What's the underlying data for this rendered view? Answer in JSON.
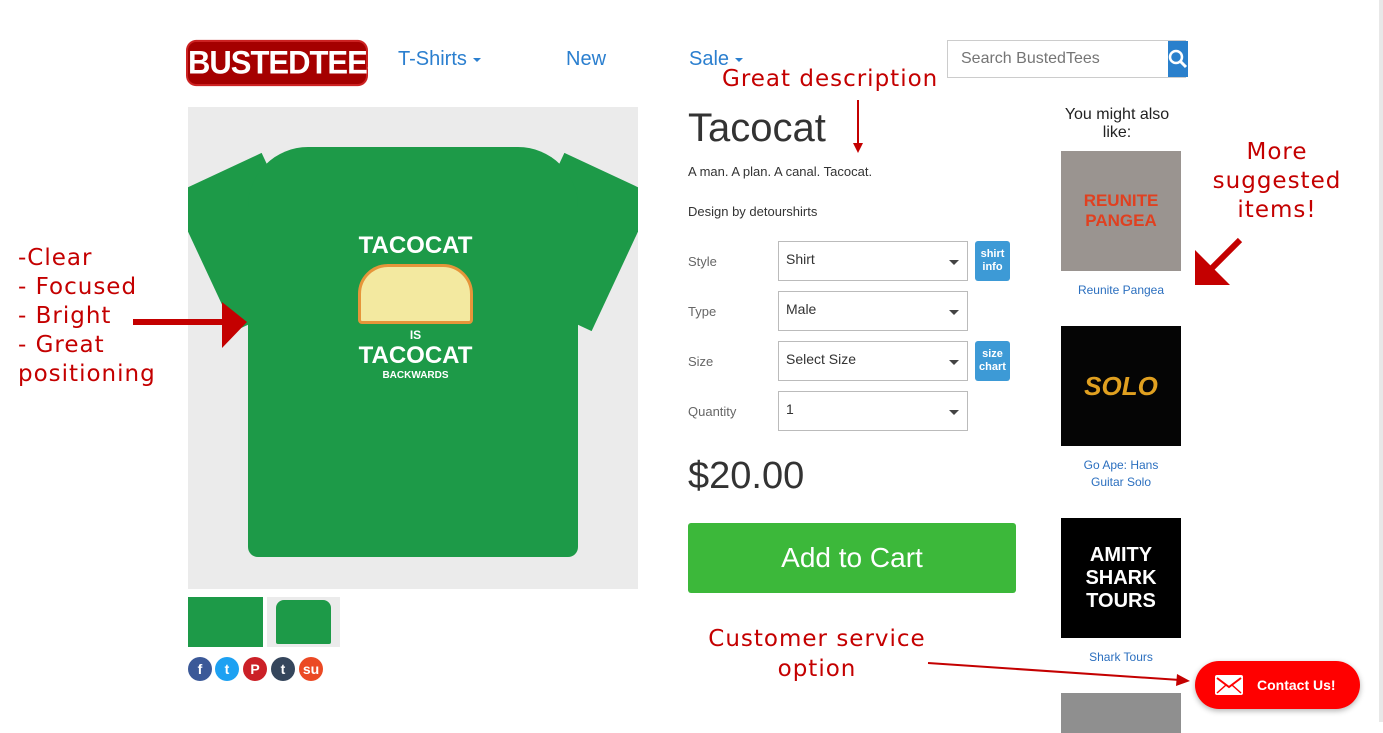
{
  "header": {
    "logo": "BUSTEDTEES",
    "nav": [
      {
        "label": "T-Shirts",
        "dropdown": true
      },
      {
        "label": "New",
        "dropdown": false
      },
      {
        "label": "Sale",
        "dropdown": true
      }
    ],
    "search_placeholder": "Search BustedTees",
    "search_icon": "search-icon"
  },
  "product": {
    "title": "Tacocat",
    "description": "A man. A plan. A canal. Tacocat.",
    "designer": "Design by detourshirts",
    "art_lines": [
      "TACOCAT",
      "IS",
      "TACOCAT",
      "BACKWARDS"
    ],
    "shirt_color": "#1d9a48",
    "options": [
      {
        "label": "Style",
        "value": "Shirt",
        "button": "shirt info"
      },
      {
        "label": "Type",
        "value": "Male"
      },
      {
        "label": "Size",
        "value": "Select Size",
        "button": "size chart"
      },
      {
        "label": "Quantity",
        "value": "1"
      }
    ],
    "price": "$20.00",
    "add_to_cart": "Add to Cart"
  },
  "social": [
    "facebook",
    "twitter",
    "pinterest",
    "tumblr",
    "stumbleupon"
  ],
  "suggestions": {
    "heading": "You might also like:",
    "items": [
      {
        "name": "Reunite Pangea",
        "art": "REUNITE PANGEA"
      },
      {
        "name": "Go Ape: Hans Guitar Solo",
        "art": "SOLO"
      },
      {
        "name": "Shark Tours",
        "art": "AMITY SHARK TOURS"
      }
    ]
  },
  "contact": {
    "label": "Contact Us!"
  },
  "annotations": {
    "description": "Great description",
    "image": [
      "-Clear",
      "- Focused",
      "- Bright",
      "- Great",
      "positioning"
    ],
    "suggested": [
      "More",
      "suggested",
      "items!"
    ],
    "service": [
      "Customer service",
      "option"
    ],
    "color": "#c40000"
  }
}
